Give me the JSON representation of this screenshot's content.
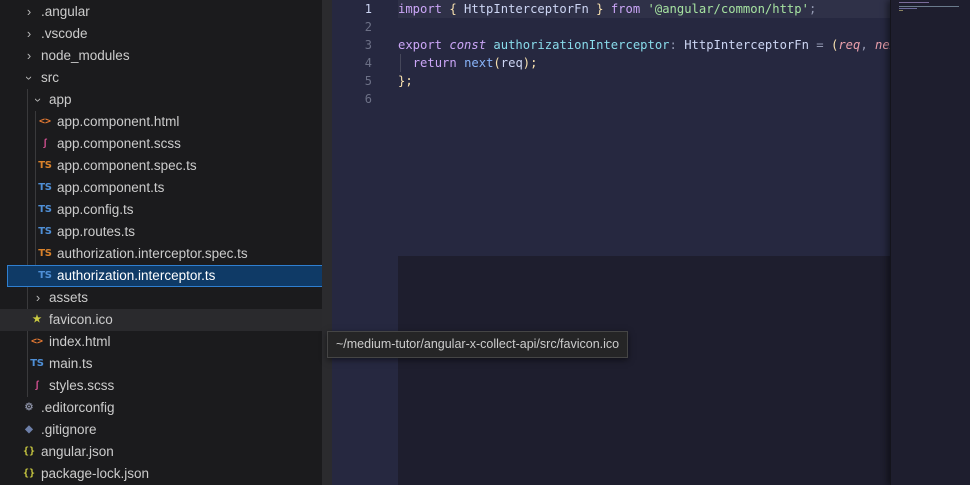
{
  "explorer": {
    "items": [
      {
        "label": ".angular",
        "type": "folder-collapsed"
      },
      {
        "label": ".vscode",
        "type": "folder-collapsed"
      },
      {
        "label": "node_modules",
        "type": "folder-collapsed"
      },
      {
        "label": "src",
        "type": "folder-expanded"
      },
      {
        "label": "app",
        "type": "folder-expanded"
      },
      {
        "label": "app.component.html",
        "icon": "html-file-icon",
        "badge": "<>"
      },
      {
        "label": "app.component.scss",
        "icon": "scss-file-icon",
        "badge": "ʃ"
      },
      {
        "label": "app.component.spec.ts",
        "icon": "ts-spec-file-icon",
        "badge": "TS"
      },
      {
        "label": "app.component.ts",
        "icon": "ts-file-icon",
        "badge": "TS"
      },
      {
        "label": "app.config.ts",
        "icon": "ts-file-icon",
        "badge": "TS"
      },
      {
        "label": "app.routes.ts",
        "icon": "ts-file-icon",
        "badge": "TS"
      },
      {
        "label": "authorization.interceptor.spec.ts",
        "icon": "ts-spec-file-icon",
        "badge": "TS"
      },
      {
        "label": "authorization.interceptor.ts",
        "icon": "ts-file-icon",
        "badge": "TS",
        "selected": true
      },
      {
        "label": "assets",
        "type": "folder-collapsed"
      },
      {
        "label": "favicon.ico",
        "icon": "star-file-icon",
        "badge": "★",
        "hover": true
      },
      {
        "label": "index.html",
        "icon": "html-file-icon",
        "badge": "<>"
      },
      {
        "label": "main.ts",
        "icon": "ts-file-icon",
        "badge": "TS"
      },
      {
        "label": "styles.scss",
        "icon": "scss-file-icon",
        "badge": "ʃ"
      },
      {
        "label": ".editorconfig",
        "icon": "gear-file-icon",
        "badge": "⚙"
      },
      {
        "label": ".gitignore",
        "icon": "git-file-icon",
        "badge": "◆"
      },
      {
        "label": "angular.json",
        "icon": "json-file-icon",
        "badge": "{}"
      },
      {
        "label": "package-lock.json",
        "icon": "json-file-icon",
        "badge": "{}"
      }
    ]
  },
  "tooltip": {
    "text": "~/medium-tutor/angular-x-collect-api/src/favicon.ico"
  },
  "editor": {
    "line_numbers": [
      "1",
      "2",
      "3",
      "4",
      "5",
      "6"
    ],
    "active_line": 1,
    "code": {
      "l1": {
        "t1": "import",
        "t2": " { ",
        "t3": "HttpInterceptorFn",
        "t4": " } ",
        "t5": "from",
        "t6": " ",
        "t7": "'@angular/common/http'",
        "t8": ";"
      },
      "l3": {
        "t1": "export",
        "t2": " ",
        "t3": "const",
        "t4": " ",
        "t5": "authorizationInterceptor",
        "t6": ": ",
        "t7": "HttpInterceptorFn",
        "t8": " = ",
        "t9": "(",
        "t10": "req",
        "t11": ", ",
        "t12": "next"
      },
      "l4": {
        "t1": "  ",
        "t2": "return",
        "t3": " ",
        "t4": "next",
        "t5": "(",
        "t6": "req",
        "t7": ");"
      },
      "l5": {
        "t1": "};"
      }
    }
  },
  "colors": {
    "selection_bg": "#0f3a66",
    "editor_bg": "#262840",
    "ts_icon": "#4f8fd6",
    "keyword": "#cba6f7",
    "string": "#a6e3a1"
  }
}
